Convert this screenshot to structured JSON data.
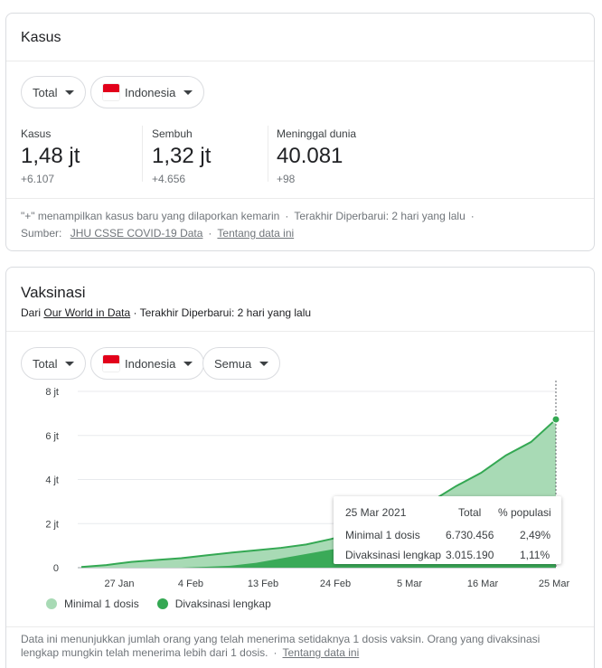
{
  "cases": {
    "title": "Kasus",
    "filters": {
      "scope": "Total",
      "country": "Indonesia"
    },
    "stats": [
      {
        "label": "Kasus",
        "value": "1,48 jt",
        "delta": "+6.107"
      },
      {
        "label": "Sembuh",
        "value": "1,32 jt",
        "delta": "+4.656"
      },
      {
        "label": "Meninggal dunia",
        "value": "40.081",
        "delta": "+98"
      }
    ],
    "footer": {
      "note": "\"+\" menampilkan kasus baru yang dilaporkan kemarin",
      "updated": "Terakhir Diperbarui: 2 hari yang lalu",
      "source_label": "Sumber:",
      "source_link": "JHU CSSE COVID-19 Data",
      "about_link": "Tentang data ini"
    }
  },
  "vaccination": {
    "title": "Vaksinasi",
    "from_label": "Dari",
    "source_link": "Our World in Data",
    "updated": "· Terakhir Diperbarui: 2 hari yang lalu",
    "filters": {
      "scope": "Total",
      "country": "Indonesia",
      "dose": "Semua"
    },
    "tooltip": {
      "date": "25 Mar 2021",
      "col_total": "Total",
      "col_pct": "% populasi",
      "rows": [
        {
          "label": "Minimal 1 dosis",
          "total": "6.730.456",
          "pct": "2,49%"
        },
        {
          "label": "Divaksinasi lengkap",
          "total": "3.015.190",
          "pct": "1,11%"
        }
      ]
    },
    "legend": [
      "Minimal 1 dosis",
      "Divaksinasi lengkap"
    ],
    "footer": {
      "text": "Data ini menunjukkan jumlah orang yang telah menerima setidaknya 1 dosis vaksin. Orang yang divaksinasi lengkap mungkin telah menerima lebih dari 1 dosis.",
      "about_link": "Tentang data ini"
    }
  },
  "colors": {
    "light_green": "#a8dab5",
    "dark_green": "#34a853",
    "accent_line": "#34a853"
  },
  "chart_data": {
    "type": "area",
    "x_tick_labels": [
      "27 Jan",
      "4 Feb",
      "13 Feb",
      "24 Feb",
      "5 Mar",
      "16 Mar",
      "25 Mar"
    ],
    "y_tick_labels": [
      "0",
      "2 jt",
      "4 jt",
      "6 jt",
      "8 jt"
    ],
    "ylim": [
      0,
      8000000
    ],
    "grid": true,
    "legend_position": "bottom-left",
    "x": [
      "14 Jan",
      "17 Jan",
      "20 Jan",
      "23 Jan",
      "27 Jan",
      "31 Jan",
      "4 Feb",
      "8 Feb",
      "13 Feb",
      "18 Feb",
      "24 Feb",
      "28 Feb",
      "5 Mar",
      "8 Mar",
      "11 Mar",
      "14 Mar",
      "16 Mar",
      "19 Mar",
      "22 Mar",
      "25 Mar"
    ],
    "series": [
      {
        "name": "Minimal 1 dosis",
        "values": [
          30000,
          120000,
          260000,
          350000,
          430000,
          560000,
          680000,
          790000,
          900000,
          1050000,
          1300000,
          1600000,
          2000000,
          2500000,
          3000000,
          3700000,
          4300000,
          5100000,
          5700000,
          6730456
        ]
      },
      {
        "name": "Divaksinasi lengkap",
        "values": [
          0,
          0,
          0,
          0,
          0,
          40000,
          90000,
          220000,
          420000,
          620000,
          820000,
          980000,
          1100000,
          1250000,
          1450000,
          1700000,
          1950000,
          2300000,
          2650000,
          3015190
        ]
      }
    ]
  }
}
